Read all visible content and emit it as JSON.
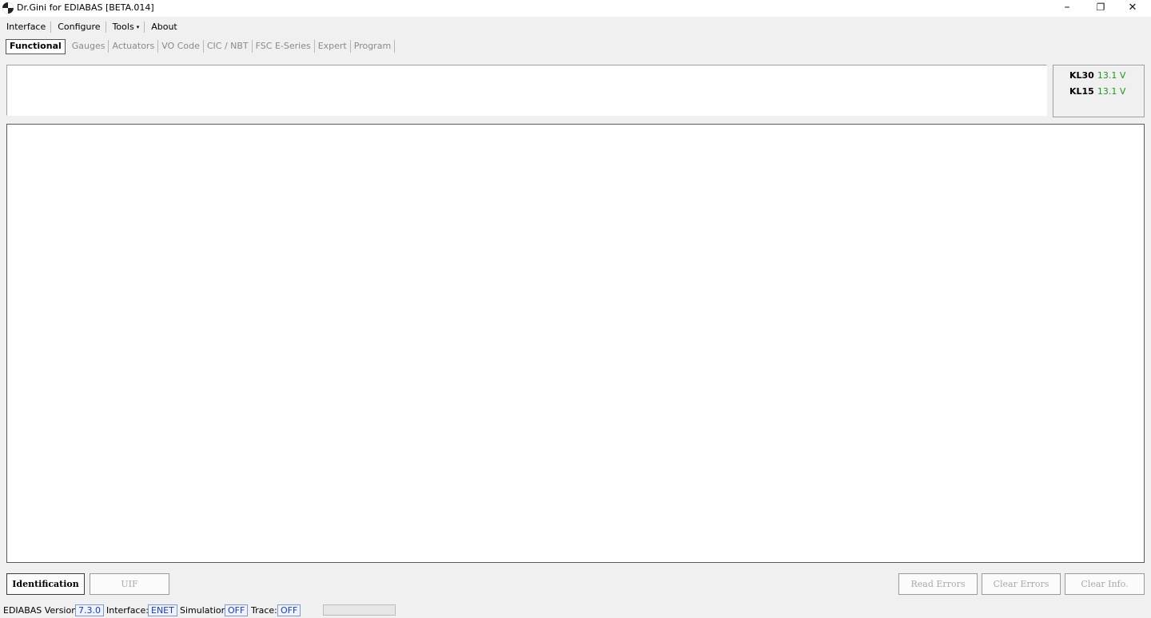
{
  "window": {
    "title": "Dr.Gini for EDIABAS [BETA.014]",
    "controls": {
      "minimize": "–",
      "restore": "❐",
      "close": "✕"
    }
  },
  "menu": {
    "items": [
      {
        "label": "Interface"
      },
      {
        "label": "Configure"
      },
      {
        "label": "Tools",
        "caret": "▾"
      },
      {
        "label": "About"
      }
    ]
  },
  "tabs": [
    {
      "label": "Functional",
      "active": true
    },
    {
      "label": "Gauges"
    },
    {
      "label": "Actuators"
    },
    {
      "label": "VO Code"
    },
    {
      "label": "CIC / NBT"
    },
    {
      "label": "FSC E-Series"
    },
    {
      "label": "Expert"
    },
    {
      "label": "Program"
    }
  ],
  "voltages": {
    "kl30": {
      "label": "KL30",
      "value": "13.1 V"
    },
    "kl15": {
      "label": "KL15",
      "value": "13.1 V"
    },
    "value_color": "#1a9a1a"
  },
  "buttons": {
    "identification": "Identification",
    "uif": "UIF",
    "read_errors": "Read Errors",
    "clear_errors": "Clear Errors",
    "clear_info": "Clear Info."
  },
  "status": {
    "ediabas_label": "EDIABAS Version:",
    "ediabas_value": "7.3.0",
    "interface_label": "Interface:",
    "interface_value": "ENET",
    "simulation_label": "Simulation:",
    "simulation_value": "OFF",
    "trace_label": "Trace:",
    "trace_value": "OFF"
  },
  "icons": {
    "app": "bmw-roundel-icon",
    "tools_dropdown": "chevron-down-icon"
  }
}
